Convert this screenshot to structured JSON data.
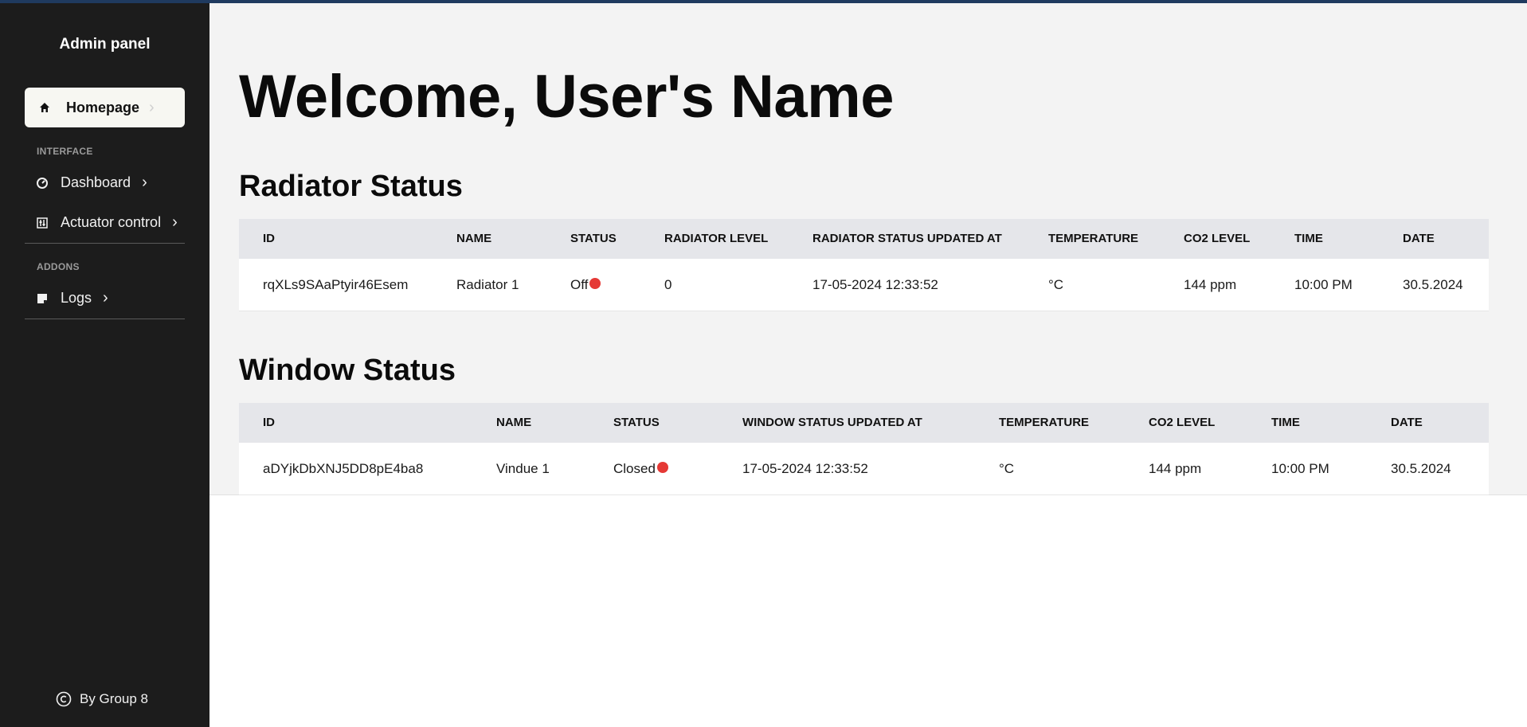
{
  "sidebar": {
    "brand": "Admin panel",
    "active_item": {
      "label": "Homepage",
      "icon": "home-icon"
    },
    "sections": [
      {
        "label": "INTERFACE"
      },
      {
        "label": "ADDONS"
      }
    ],
    "items": [
      {
        "label": "Dashboard",
        "icon": "gauge-icon"
      },
      {
        "label": "Actuator control",
        "icon": "sliders-icon"
      },
      {
        "label": "Logs",
        "icon": "note-icon"
      }
    ],
    "footer": "By Group 8"
  },
  "main": {
    "welcome": "Welcome, User's Name",
    "radiator": {
      "title": "Radiator Status",
      "headers": [
        "ID",
        "NAME",
        "STATUS",
        "RADIATOR LEVEL",
        "RADIATOR STATUS UPDATED AT",
        "TEMPERATURE",
        "CO2 LEVEL",
        "TIME",
        "DATE"
      ],
      "row": {
        "id": "rqXLs9SAaPtyir46Esem",
        "name": "Radiator 1",
        "status": "Off",
        "level": "0",
        "updated": "17-05-2024 12:33:52",
        "temperature": "°C",
        "co2": "144 ppm",
        "time": "10:00 PM",
        "date": "30.5.2024"
      }
    },
    "window": {
      "title": "Window Status",
      "headers": [
        "ID",
        "NAME",
        "STATUS",
        "WINDOW STATUS UPDATED AT",
        "TEMPERATURE",
        "CO2 LEVEL",
        "TIME",
        "DATE"
      ],
      "row": {
        "id": "aDYjkDbXNJ5DD8pE4ba8",
        "name": "Vindue 1",
        "status": "Closed",
        "updated": "17-05-2024 12:33:52",
        "temperature": "°C",
        "co2": "144 ppm",
        "time": "10:00 PM",
        "date": "30.5.2024"
      }
    }
  },
  "colors": {
    "sidebar_bg": "#1c1c1c",
    "status_dot": "#e53935",
    "header_bg": "#e5e6ea",
    "main_bg": "#f3f3f3"
  }
}
